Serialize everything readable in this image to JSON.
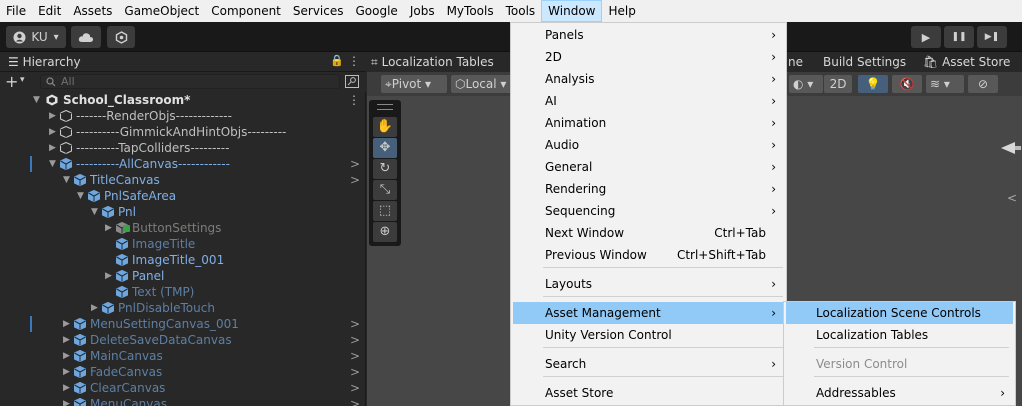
{
  "menubar": [
    "File",
    "Edit",
    "Assets",
    "GameObject",
    "Component",
    "Services",
    "Google",
    "Jobs",
    "MyTools",
    "Tools",
    "Window",
    "Help"
  ],
  "toolbar": {
    "account": "KU",
    "account_chevron": "▾",
    "play": "▶",
    "pause": "❚❚",
    "step": "▶❚"
  },
  "hierarchy": {
    "title": "Hierarchy",
    "lock": "🔒",
    "more": "⋮",
    "add": "+",
    "add_chevron": "▾",
    "search_placeholder": "All",
    "scene_name": "School_Classroom*",
    "rows": [
      {
        "label": "-------RenderObjs-------------",
        "arrow": "▶",
        "indent": 0,
        "style": "gray",
        "chev": ""
      },
      {
        "label": "----------GimmickAndHintObjs---------",
        "arrow": "▶",
        "indent": 0,
        "style": "gray",
        "chev": ""
      },
      {
        "label": "----------TapColliders---------",
        "arrow": "▶",
        "indent": 0,
        "style": "gray",
        "chev": ""
      },
      {
        "label": "----------AllCanvas------------",
        "arrow": "▼",
        "indent": 0,
        "style": "blue",
        "chev": ">"
      },
      {
        "label": "TitleCanvas",
        "arrow": "▼",
        "indent": 1,
        "style": "blue",
        "chev": ">"
      },
      {
        "label": "PnlSafeArea",
        "arrow": "▼",
        "indent": 2,
        "style": "blue",
        "chev": ""
      },
      {
        "label": "Pnl",
        "arrow": "▼",
        "indent": 3,
        "style": "blue",
        "chev": ""
      },
      {
        "label": "ButtonSettings",
        "arrow": "▶",
        "indent": 4,
        "style": "faded",
        "chev": ""
      },
      {
        "label": "ImageTitle",
        "arrow": "",
        "indent": 4,
        "style": "dimblue",
        "chev": ""
      },
      {
        "label": "ImageTitle_001",
        "arrow": "",
        "indent": 4,
        "style": "blue",
        "chev": ""
      },
      {
        "label": "Panel",
        "arrow": "▶",
        "indent": 4,
        "style": "blue",
        "chev": ""
      },
      {
        "label": "Text (TMP)",
        "arrow": "",
        "indent": 4,
        "style": "dimblue",
        "chev": ""
      },
      {
        "label": "PnlDisableTouch",
        "arrow": "▶",
        "indent": 3,
        "style": "dimblue",
        "chev": ""
      },
      {
        "label": "MenuSettingCanvas_001",
        "arrow": "▶",
        "indent": 1,
        "style": "dimblue",
        "chev": ">"
      },
      {
        "label": "DeleteSaveDataCanvas",
        "arrow": "▶",
        "indent": 1,
        "style": "dimblue",
        "chev": ">"
      },
      {
        "label": "MainCanvas",
        "arrow": "▶",
        "indent": 1,
        "style": "dimblue",
        "chev": ">"
      },
      {
        "label": "FadeCanvas",
        "arrow": "▶",
        "indent": 1,
        "style": "dimblue",
        "chev": ">"
      },
      {
        "label": "ClearCanvas",
        "arrow": "▶",
        "indent": 1,
        "style": "dimblue",
        "chev": ">"
      },
      {
        "label": "MenuCanvas",
        "arrow": "▶",
        "indent": 1,
        "style": "dimblue",
        "chev": ">"
      }
    ]
  },
  "scene": {
    "tab_localization": "Localization Tables",
    "tab_partial": "ne",
    "tab_build": "Build Settings",
    "tab_store": "Asset Store",
    "pivot": "Pivot",
    "local": "Local",
    "btn_2d": "2D"
  },
  "window_menu": {
    "items": [
      {
        "label": "Panels",
        "shortcut": "",
        "submenu": true
      },
      {
        "label": "2D",
        "shortcut": "",
        "submenu": true
      },
      {
        "label": "Analysis",
        "shortcut": "",
        "submenu": true
      },
      {
        "label": "AI",
        "shortcut": "",
        "submenu": true
      },
      {
        "label": "Animation",
        "shortcut": "",
        "submenu": true
      },
      {
        "label": "Audio",
        "shortcut": "",
        "submenu": true
      },
      {
        "label": "General",
        "shortcut": "",
        "submenu": true
      },
      {
        "label": "Rendering",
        "shortcut": "",
        "submenu": true
      },
      {
        "label": "Sequencing",
        "shortcut": "",
        "submenu": true
      },
      {
        "label": "Next Window",
        "shortcut": "Ctrl+Tab",
        "submenu": false
      },
      {
        "label": "Previous Window",
        "shortcut": "Ctrl+Shift+Tab",
        "submenu": false
      },
      {
        "label": "Layouts",
        "shortcut": "",
        "submenu": true
      },
      {
        "label": "Asset Management",
        "shortcut": "",
        "submenu": true
      },
      {
        "label": "Unity Version Control",
        "shortcut": "",
        "submenu": false
      },
      {
        "label": "Search",
        "shortcut": "",
        "submenu": true
      },
      {
        "label": "Asset Store",
        "shortcut": "",
        "submenu": false
      }
    ]
  },
  "asset_submenu": {
    "items": [
      {
        "label": "Localization Scene Controls",
        "submenu": false,
        "disabled": false
      },
      {
        "label": "Localization Tables",
        "submenu": false,
        "disabled": false
      },
      {
        "label": "Version Control",
        "submenu": false,
        "disabled": true
      },
      {
        "label": "Addressables",
        "submenu": true,
        "disabled": false
      }
    ]
  },
  "colors": {
    "menu_highlight": "#91c9f7",
    "hierarchy_blue": "#7fb0e6",
    "editor_bg": "#282828"
  }
}
